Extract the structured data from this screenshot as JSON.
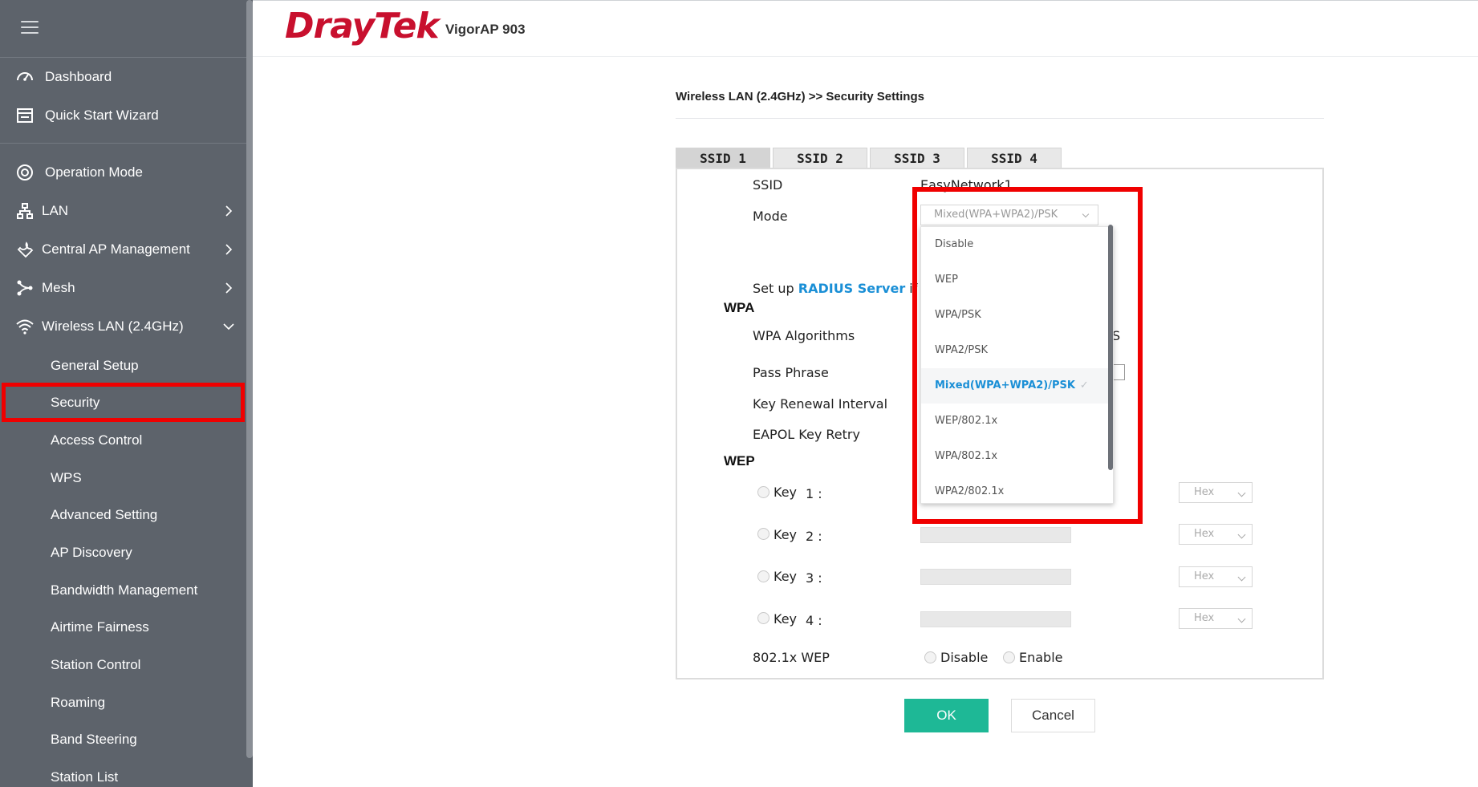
{
  "sidebar": {
    "menu_label": "menu-icon",
    "items": [
      {
        "label": "Dashboard",
        "icon": "dashboard-icon"
      },
      {
        "label": "Quick Start Wizard",
        "icon": "wizard-icon"
      },
      {
        "label": "Operation Mode",
        "icon": "operation-mode-icon"
      },
      {
        "label": "LAN",
        "icon": "lan-icon"
      },
      {
        "label": "Central AP Management",
        "icon": "wrench-icon"
      },
      {
        "label": "Mesh",
        "icon": "mesh-icon"
      },
      {
        "label": "Wireless LAN (2.4GHz)",
        "icon": "wifi-icon"
      }
    ],
    "subitems": [
      {
        "label": "General Setup"
      },
      {
        "label": "Security"
      },
      {
        "label": "Access Control"
      },
      {
        "label": "WPS"
      },
      {
        "label": "Advanced Setting"
      },
      {
        "label": "AP Discovery"
      },
      {
        "label": "Bandwidth Management"
      },
      {
        "label": "Airtime Fairness"
      },
      {
        "label": "Station Control"
      },
      {
        "label": "Roaming"
      },
      {
        "label": "Band Steering"
      },
      {
        "label": "Station List"
      }
    ],
    "active_subitem": "Security",
    "highlight_color": "#f00000"
  },
  "header": {
    "brand": "DrayTek",
    "model": "VigorAP 903",
    "brand_color": "#c8102e"
  },
  "page": {
    "breadcrumb": "Wireless LAN (2.4GHz) >> Security Settings",
    "tabs": [
      "SSID 1",
      "SSID 2",
      "SSID 3",
      "SSID 4"
    ],
    "active_tab": "SSID 1",
    "ssid_label": "SSID",
    "ssid_value": "EasyNetwork1",
    "mode_label": "Mode",
    "mode_value": "Mixed(WPA+WPA2)/PSK",
    "radius_prefix": "Set up ",
    "radius_link": "RADIUS Server",
    "radius_suffix": " if 80",
    "wpa_section": "WPA",
    "wpa_algorithms_label": "WPA Algorithms",
    "wpa_algorithms_partial": "S",
    "pass_phrase_label": "Pass Phrase",
    "key_renewal_label": "Key Renewal Interval",
    "eapol_label": "EAPOL Key Retry",
    "wep_section": "WEP",
    "wep_keys": [
      {
        "label": "Key",
        "num": "1 :",
        "format": "Hex"
      },
      {
        "label": "Key",
        "num": "2 :",
        "format": "Hex"
      },
      {
        "label": "Key",
        "num": "3 :",
        "format": "Hex"
      },
      {
        "label": "Key",
        "num": "4 :",
        "format": "Hex"
      }
    ],
    "wep8021x_label": "802.1x WEP",
    "wep8021x_disable": "Disable",
    "wep8021x_enable": "Enable"
  },
  "dropdown": {
    "options": [
      "Disable",
      "WEP",
      "WPA/PSK",
      "WPA2/PSK",
      "Mixed(WPA+WPA2)/PSK",
      "WEP/802.1x",
      "WPA/802.1x",
      "WPA2/802.1x"
    ],
    "selected": "Mixed(WPA+WPA2)/PSK",
    "check": "✓",
    "accent_color": "#1a8fd6"
  },
  "buttons": {
    "ok": "OK",
    "cancel": "Cancel",
    "ok_color": "#1eb896"
  }
}
